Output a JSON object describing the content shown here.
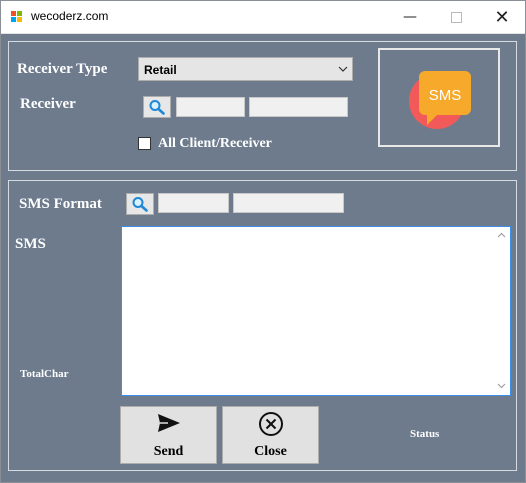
{
  "window": {
    "title": "wecoderz.com",
    "minimize_glyph": "—",
    "close_glyph": "✕"
  },
  "receiver_section": {
    "receiver_type_label": "Receiver Type",
    "receiver_type_selected": "Retail",
    "receiver_label": "Receiver",
    "receiver_code": "",
    "receiver_name": "",
    "all_client_label": "All Client/Receiver",
    "all_client_checked": false
  },
  "logo": {
    "text": "SMS",
    "icon": "sms-bubble-icon"
  },
  "sms_section": {
    "sms_format_label": "SMS Format",
    "format_code": "",
    "format_name": "",
    "sms_label": "SMS",
    "sms_text": "",
    "total_char_label": "TotalChar",
    "status_label": "Status"
  },
  "buttons": {
    "send_label": "Send",
    "close_label": "Close"
  },
  "colors": {
    "form_background": "#6d7b8d",
    "logo_orange": "#f7a92b",
    "logo_red": "#f25a5a",
    "focus_border": "#3d8ee6"
  }
}
